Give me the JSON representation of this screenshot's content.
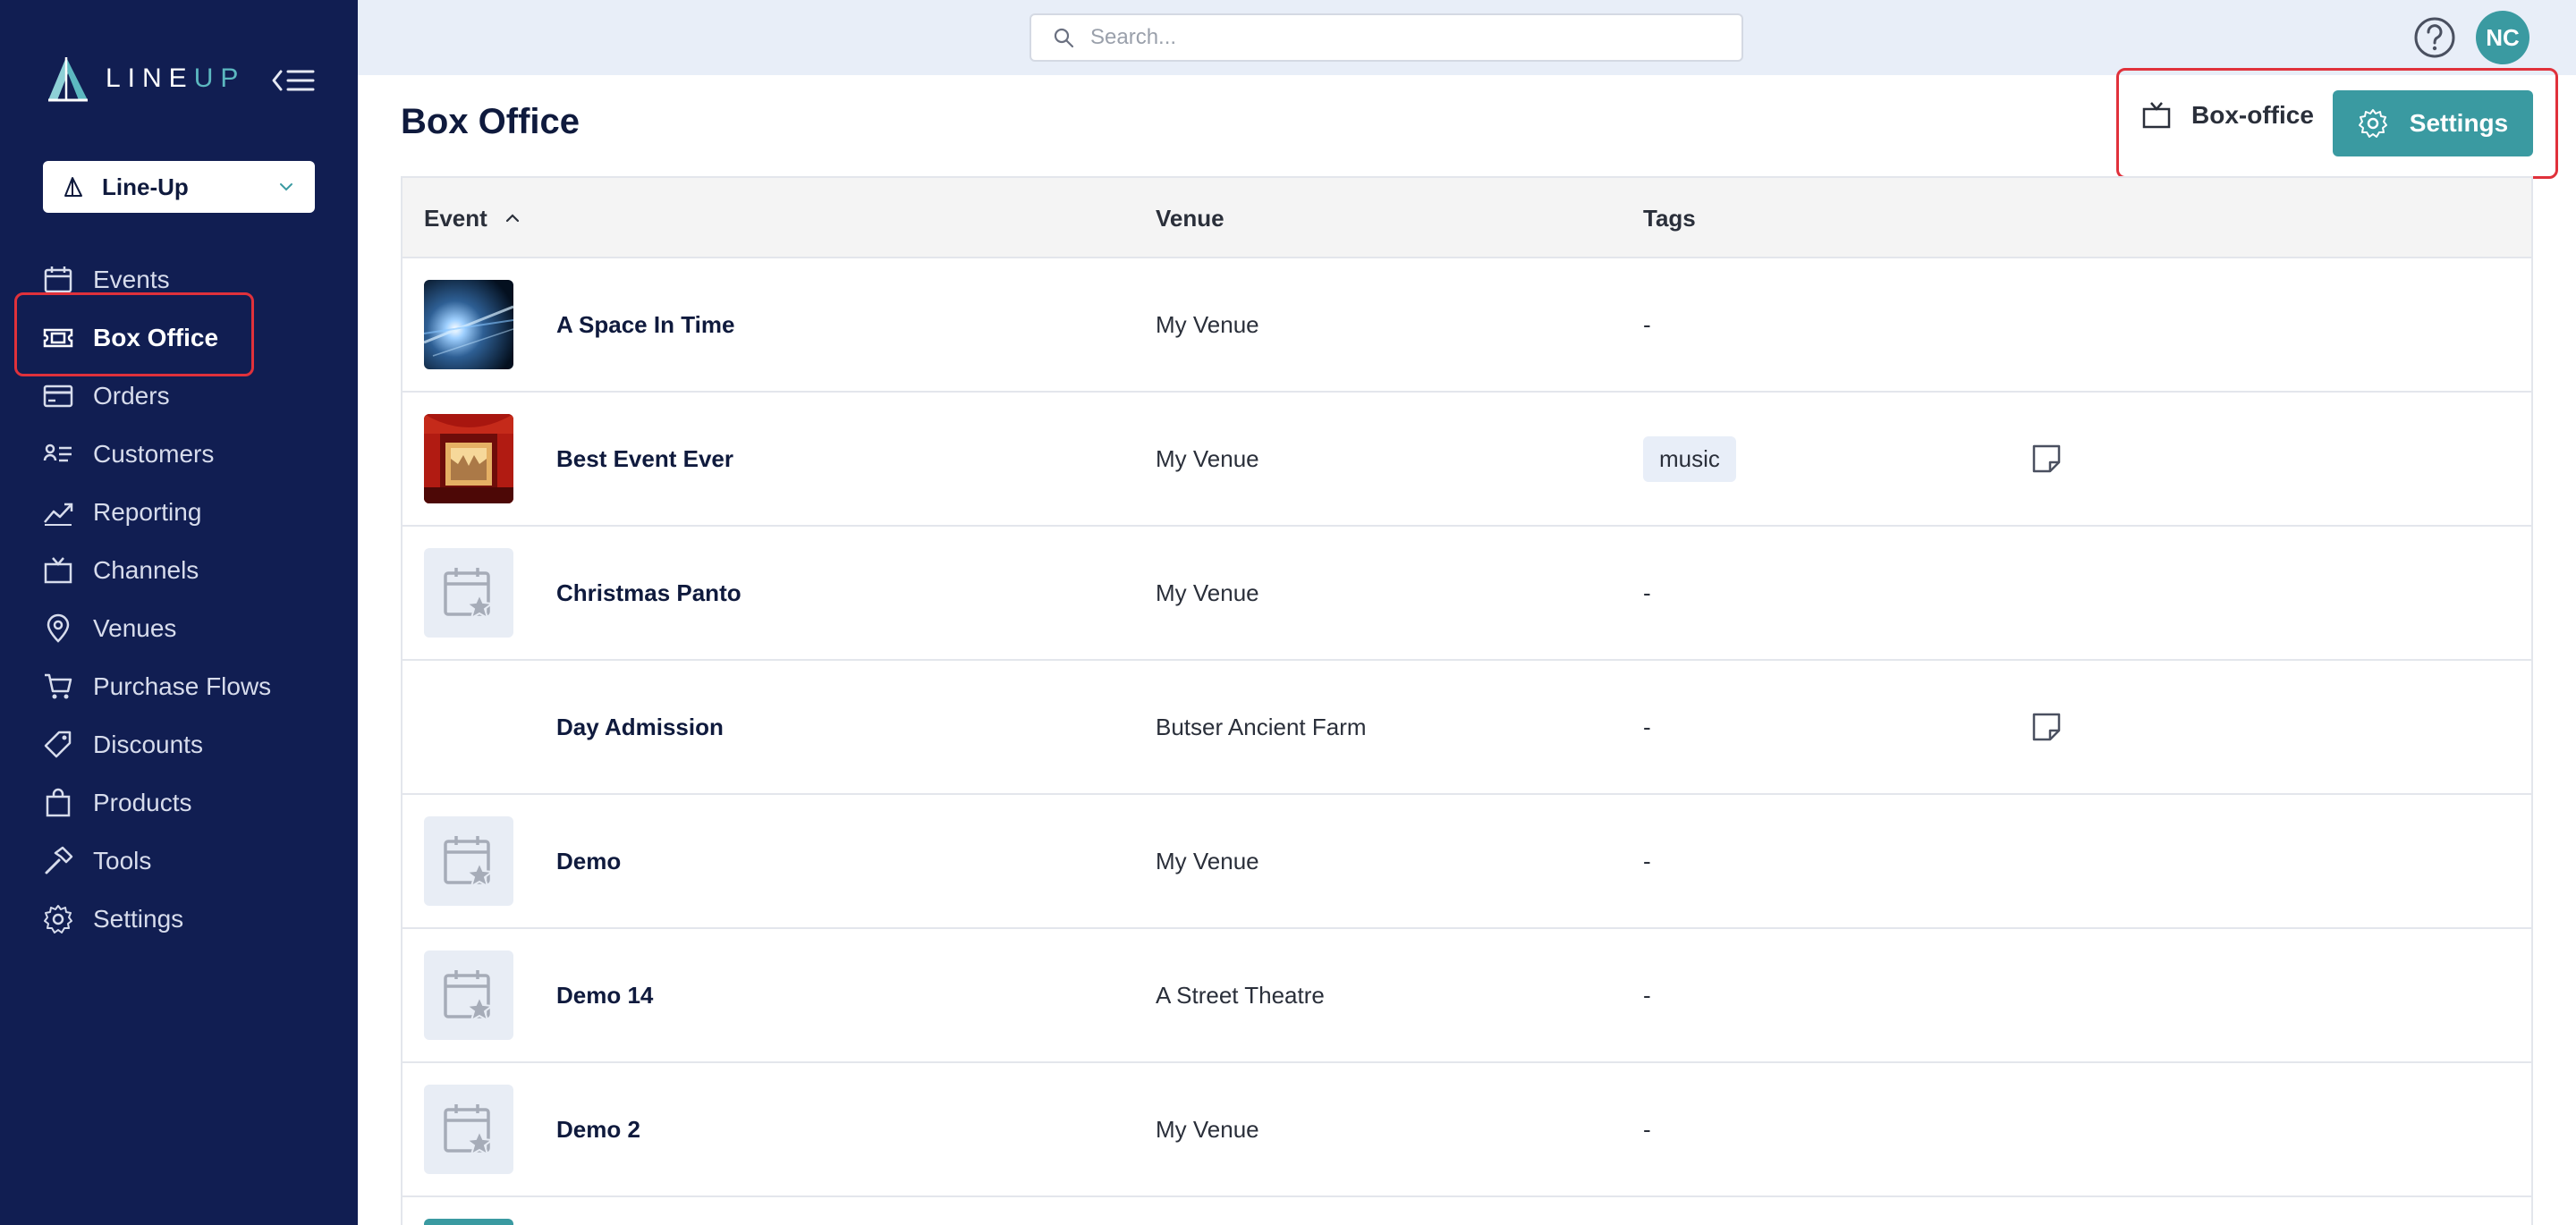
{
  "app": {
    "brand_line": "LINE",
    "brand_up": "UP"
  },
  "org_selector": {
    "label": "Line-Up"
  },
  "nav": {
    "items": [
      {
        "label": "Events",
        "icon": "calendar-icon"
      },
      {
        "label": "Box Office",
        "icon": "ticket-icon",
        "active": true
      },
      {
        "label": "Orders",
        "icon": "credit-card-icon"
      },
      {
        "label": "Customers",
        "icon": "customers-icon"
      },
      {
        "label": "Reporting",
        "icon": "trend-chart-icon"
      },
      {
        "label": "Channels",
        "icon": "tv-icon"
      },
      {
        "label": "Venues",
        "icon": "map-pin-icon"
      },
      {
        "label": "Purchase Flows",
        "icon": "cart-icon"
      },
      {
        "label": "Discounts",
        "icon": "tags-icon"
      },
      {
        "label": "Products",
        "icon": "shopping-bag-icon"
      },
      {
        "label": "Tools",
        "icon": "hammer-icon"
      },
      {
        "label": "Settings",
        "icon": "gear-icon"
      }
    ]
  },
  "topbar": {
    "search_placeholder": "Search...",
    "avatar_initials": "NC"
  },
  "page": {
    "title": "Box Office",
    "boxoffice_link": "Box-office",
    "settings_button": "Settings"
  },
  "table": {
    "columns": {
      "event": "Event",
      "venue": "Venue",
      "tags": "Tags"
    },
    "rows": [
      {
        "name": "A Space In Time",
        "venue": "My Venue",
        "tags": "-",
        "thumb": "space-image",
        "note": false
      },
      {
        "name": "Best Event Ever",
        "venue": "My Venue",
        "tag": "music",
        "thumb": "theatre-image",
        "note": true
      },
      {
        "name": "Christmas Panto",
        "venue": "My Venue",
        "tags": "-",
        "thumb": "placeholder",
        "note": false
      },
      {
        "name": "Day Admission",
        "venue": "Butser Ancient Farm",
        "tags": "-",
        "thumb": "blank",
        "note": true
      },
      {
        "name": "Demo",
        "venue": "My Venue",
        "tags": "-",
        "thumb": "placeholder",
        "note": false
      },
      {
        "name": "Demo 14",
        "venue": "A Street Theatre",
        "tags": "-",
        "thumb": "placeholder",
        "note": false
      },
      {
        "name": "Demo 2",
        "venue": "My Venue",
        "tags": "-",
        "thumb": "placeholder",
        "note": false
      }
    ]
  },
  "colors": {
    "sidebar": "#111e52",
    "accent": "#3a9aa1",
    "highlight": "#e0313b"
  }
}
